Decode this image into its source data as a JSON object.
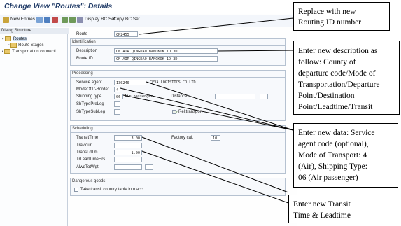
{
  "window": {
    "title": "Change View \"Routes\": Details"
  },
  "toolbar": {
    "new_entries": "New Entries",
    "display_bc_set": "Display BC Set",
    "copy_bc_set": "Copy BC Set"
  },
  "tree": {
    "header": "Dialog Structure",
    "items": [
      "Routes",
      "Route Stages",
      "Transportation connecti"
    ]
  },
  "route": {
    "label": "Route",
    "value": "CN2455"
  },
  "identification": {
    "title": "Identification",
    "description_label": "Description",
    "description_value": "CN AIR QINGDAO BANGKOK 1D 3D",
    "route_id_label": "Route ID",
    "route_id_value": "CN AIR QINGDAO BANGKOK 1D 3D"
  },
  "processing": {
    "title": "Processing",
    "service_agent_label": "Service agent",
    "service_agent_value": "130240",
    "service_agent_name": "CEVA LOGISTICS CO.LTD",
    "mode_label": "ModeOfTr-Border",
    "mode_value": "4",
    "shipping_type_label": "Shipping type",
    "shipping_type_value": "06",
    "shipping_type_text": "Air passenger",
    "distance_label": "Distance",
    "shtypepreleg_label": "ShTypePreLeg",
    "shtypesubleg_label": "ShTypeSubLeg",
    "reltransport_label": "Rel.transport"
  },
  "scheduling": {
    "title": "Scheduling",
    "transit_time_label": "TransitTime",
    "transit_time_value": "3.00",
    "factory_cal_label": "Factory cal.",
    "factory_cal_value": "10",
    "trav_dur_label": "Trav.dur.",
    "transldtm_label": "TransLdTm.",
    "transldtm_value": "1.00",
    "trleadtimehrs_label": "TrLeadTimeHrs",
    "alwdtotwgt_label": "AlwdTotWgt"
  },
  "dangerous_goods": {
    "title": "Dangerous goods",
    "checkbox_label": "Take transit country table into acc."
  },
  "callouts": {
    "routing_id": [
      "Replace with new",
      "Routing ID number"
    ],
    "description": [
      "Enter new description as",
      "follow: County of",
      "departure code/Mode of",
      "Transportation/Departure",
      "Point/Destination",
      "Point/Leadtime/Transit"
    ],
    "service_agent": [
      "Enter new data: Service",
      "agent code (optional),",
      "Mode of Transport: 4",
      "(Air), Shipping Type:",
      "06 (Air passenger)"
    ],
    "transit": [
      "Enter new Transit",
      "Time & Leadtime"
    ]
  }
}
